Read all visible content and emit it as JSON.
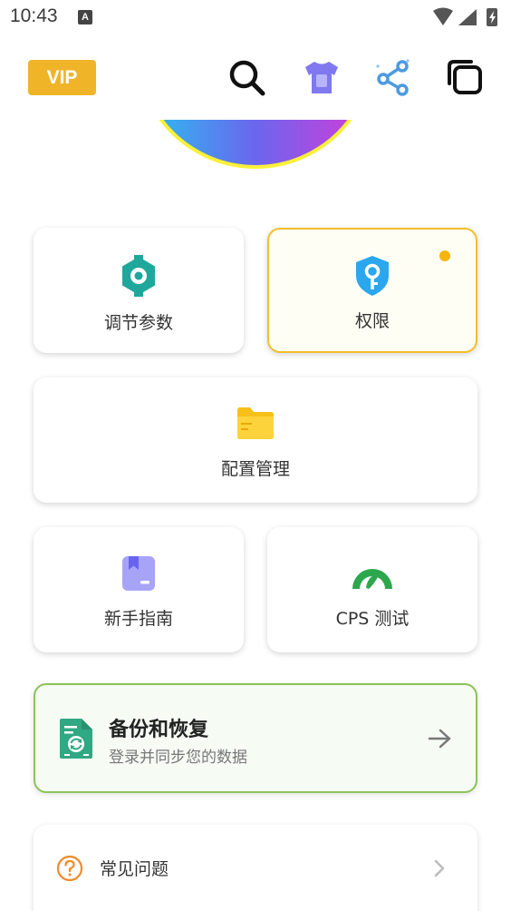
{
  "status_bar": {
    "time": "10:43",
    "notification_icon": "A"
  },
  "top_bar": {
    "vip_label": "VIP",
    "icons": [
      "search-icon",
      "tshirt-icon",
      "share-icon",
      "copy-icon"
    ]
  },
  "tiles": {
    "adjust_params": {
      "label": "调节参数",
      "icon": "gear-icon",
      "icon_color": "#1fa79c"
    },
    "permissions": {
      "label": "权限",
      "icon": "shield-key-icon",
      "icon_color": "#2aa7ee",
      "accent": "#f2bf2a"
    },
    "config_manage": {
      "label": "配置管理",
      "icon": "folder-icon",
      "icon_color": "#f7bf1a"
    },
    "beginner_guide": {
      "label": "新手指南",
      "icon": "bookmark-icon",
      "icon_color": "#8b87f5"
    },
    "cps_test": {
      "label": "CPS 测试",
      "icon": "speedometer-icon",
      "icon_color": "#2da74d"
    }
  },
  "backup": {
    "title": "备份和恢复",
    "subtitle": "登录并同步您的数据",
    "icon": "file-sync-icon",
    "accent": "#8cc45a"
  },
  "faq": {
    "label": "常见问题",
    "icon": "question-circle-icon",
    "icon_color": "#f08a2c"
  }
}
